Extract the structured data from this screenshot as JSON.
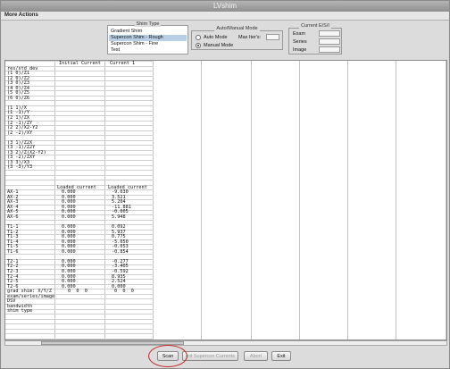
{
  "window": {
    "title": "LVshim"
  },
  "menu": {
    "more_actions": "More Actions"
  },
  "shim_type": {
    "header": "Shim Type",
    "options": [
      "Gradient Shim",
      "Supercon Shim - Rough",
      "Supercon Shim - Fine",
      "Test"
    ],
    "selected": "Supercon Shim - Rough"
  },
  "mode": {
    "header": "Auto/Manual Mode",
    "auto": "Auto Mode",
    "manual": "Manual Mode",
    "selected": "Manual Mode",
    "max_iter_label": "Max Iter's:",
    "max_iter_value": ""
  },
  "current_esi": {
    "header": "Current E/S/I",
    "exam_label": "Exam",
    "series_label": "Series",
    "image_label": "Image",
    "exam": "",
    "series": "",
    "image": ""
  },
  "table": {
    "col_headers": [
      "",
      "Initial Current",
      "Current 1"
    ],
    "header_row": "res/std dev",
    "names": [
      "(1 0)/Z1",
      "(2 0)/Z2",
      "(3 0)/Z3",
      "(4 0)/Z4",
      "(5 0)/Z5",
      "(6 0)/Z6",
      "",
      "(1 1)/X",
      "(1 -1)/Y",
      "(2 1)/ZX",
      "(2 -1)/ZY",
      "(2 2)/X2-Y2",
      "(2 -2)/XY",
      "",
      "(3 1)/Z2X",
      "(3 -1)/Z2Y",
      "(3 2)/Z(X2-Y2)",
      "(3 -2)/ZXY",
      "(3 3)/X3",
      "(3 -3)/Y3"
    ],
    "loaded_label": "Loaded current",
    "rows": [
      {
        "name": "AX-1",
        "init": "0.000",
        "cur": "-9.030"
      },
      {
        "name": "AX-2",
        "init": "0.000",
        "cur": "3.521"
      },
      {
        "name": "AX-3",
        "init": "0.000",
        "cur": "5.204"
      },
      {
        "name": "AX-4",
        "init": "0.000",
        "cur": "-11.881"
      },
      {
        "name": "AX-5",
        "init": "0.000",
        "cur": "-0.005"
      },
      {
        "name": "AX-6",
        "init": "0.000",
        "cur": "5.948"
      },
      {
        "name": "",
        "init": "",
        "cur": ""
      },
      {
        "name": "T1-1",
        "init": "0.000",
        "cur": "0.092"
      },
      {
        "name": "T1-2",
        "init": "0.000",
        "cur": "5.937"
      },
      {
        "name": "T1-3",
        "init": "0.000",
        "cur": "0.775"
      },
      {
        "name": "T1-4",
        "init": "0.000",
        "cur": "-5.050"
      },
      {
        "name": "T1-5",
        "init": "0.000",
        "cur": "-0.053"
      },
      {
        "name": "T1-6",
        "init": "0.000",
        "cur": "-0.854"
      },
      {
        "name": "",
        "init": "",
        "cur": ""
      },
      {
        "name": "T2-1",
        "init": "0.000",
        "cur": "-0.277"
      },
      {
        "name": "T2-2",
        "init": "0.000",
        "cur": "-3.405"
      },
      {
        "name": "T2-3",
        "init": "0.000",
        "cur": "-0.592"
      },
      {
        "name": "T2-4",
        "init": "0.000",
        "cur": "8.935"
      },
      {
        "name": "T2-5",
        "init": "0.000",
        "cur": "2.524"
      },
      {
        "name": "T2-6",
        "init": "0.000",
        "cur": "0.000"
      }
    ],
    "grad_shim_label": "grad shim: X/Y/Z",
    "grad_init": "0  0  0",
    "grad_cur": "0  0  0",
    "footer_rows": [
      "exam/series/image",
      "DSV",
      "bandwidth",
      "shim type"
    ]
  },
  "buttons": {
    "scan": "Scan",
    "init": "Init Supercon Currents",
    "abort": "Abort",
    "exit": "Exit"
  }
}
